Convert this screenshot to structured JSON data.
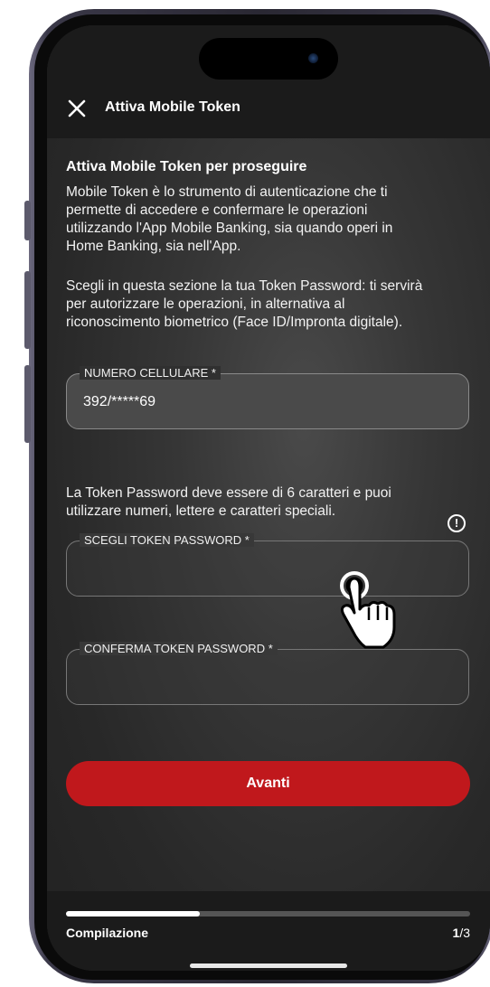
{
  "header": {
    "title": "Attiva Mobile Token"
  },
  "intro": {
    "heading": "Attiva Mobile Token per proseguire",
    "paragraph1_line1": "Mobile Token è lo strumento di autenticazione che ti",
    "paragraph1_line2": "permette di accedere e confermare le operazioni",
    "paragraph1_line3": "utilizzando l'App Mobile Banking, sia quando operi in",
    "paragraph1_line4": "Home Banking, sia nell'App.",
    "paragraph2_line1": "Scegli in questa sezione la tua Token Password: ti servirà",
    "paragraph2_line2": "per autorizzare le operazioni, in alternativa al",
    "paragraph2_line3": "riconoscimento biometrico (Face ID/Impronta digitale)."
  },
  "phone_field": {
    "label": "NUMERO CELLULARE *",
    "value": "392/*****69"
  },
  "password_hint": {
    "line1": "La Token Password deve essere di 6 caratteri e puoi",
    "line2": "utilizzare numeri, lettere e caratteri speciali."
  },
  "token_password_field": {
    "label": "SCEGLI TOKEN PASSWORD *"
  },
  "confirm_password_field": {
    "label": "CONFERMA TOKEN PASSWORD *"
  },
  "actions": {
    "next_label": "Avanti"
  },
  "progress": {
    "label": "Compilazione",
    "current": "1",
    "total": "/3",
    "fraction": 0.33
  },
  "colors": {
    "accent": "#c0181c",
    "background": "#2e2e2e",
    "bar": "#1b1b1b"
  }
}
